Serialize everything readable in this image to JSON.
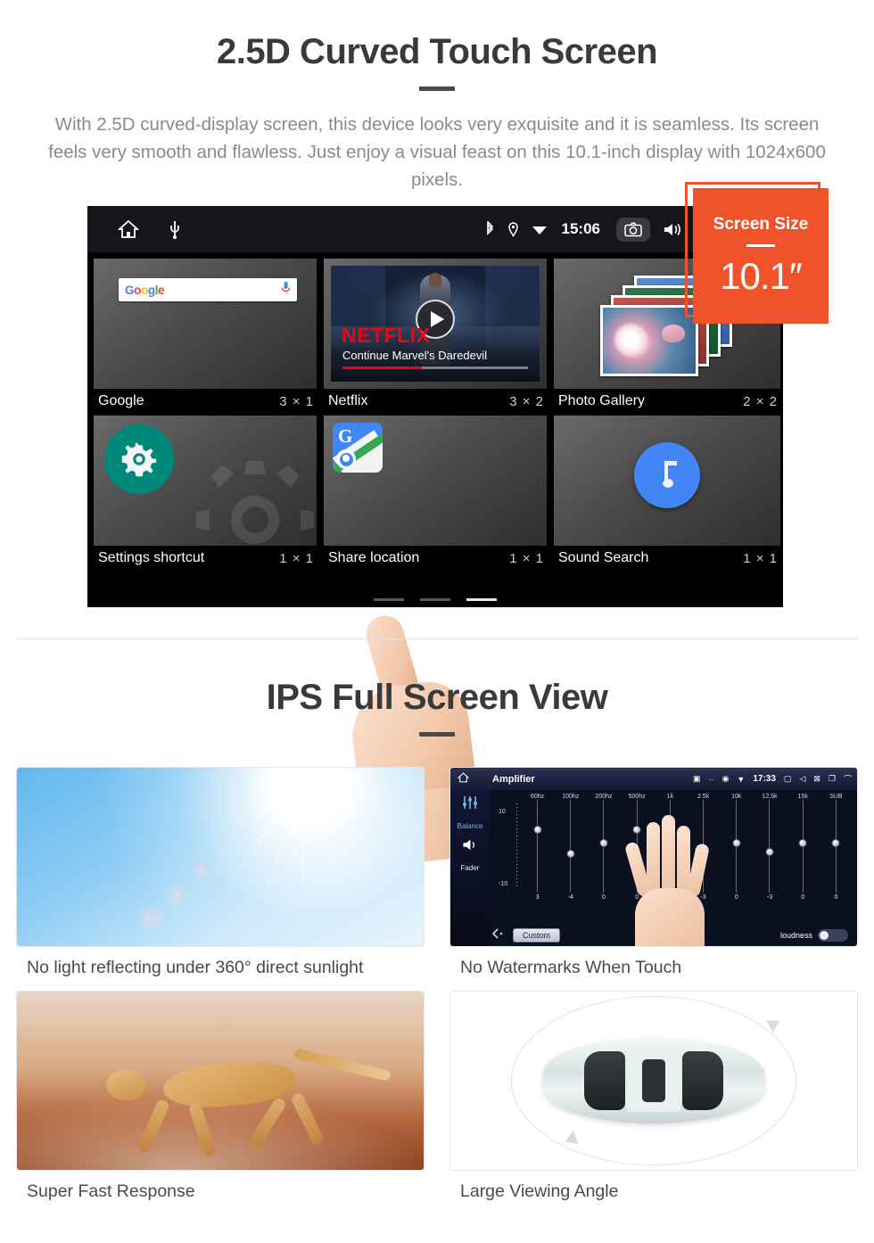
{
  "section1": {
    "title": "2.5D Curved Touch Screen",
    "description": "With 2.5D curved-display screen, this device looks very exquisite and it is seamless. Its screen feels very smooth and flawless. Just enjoy a visual feast on this 10.1-inch display with 1024x600 pixels."
  },
  "badge": {
    "title": "Screen Size",
    "value": "10.1″",
    "color": "#F0522A"
  },
  "device": {
    "statusbar": {
      "time": "15:06",
      "left_icons": [
        "home-icon",
        "usb-icon"
      ],
      "right_icons": [
        "bluetooth-icon",
        "location-icon",
        "wifi-icon",
        "camera-icon",
        "volume-icon",
        "close-icon",
        "recents-icon",
        "back-icon"
      ]
    },
    "widgets": [
      {
        "label": "Google",
        "size": "3 × 1",
        "icon": "google-search-widget"
      },
      {
        "label": "Netflix",
        "size": "3 × 2",
        "icon": "netflix-widget"
      },
      {
        "label": "Photo Gallery",
        "size": "2 × 2",
        "icon": "photo-gallery-widget"
      },
      {
        "label": "Settings shortcut",
        "size": "1 × 1",
        "icon": "settings-gear-icon"
      },
      {
        "label": "Share location",
        "size": "1 × 1",
        "icon": "google-maps-icon"
      },
      {
        "label": "Sound Search",
        "size": "1 × 1",
        "icon": "music-note-icon"
      }
    ],
    "google_widget": {
      "logo": "Google",
      "mic": "mic-icon"
    },
    "netflix_widget": {
      "brand": "NETFLIX",
      "subtitle": "Continue Marvel's Daredevil",
      "progress_percent": 43
    },
    "page_indicator": {
      "count": 3,
      "active": 3
    }
  },
  "section2": {
    "title": "IPS Full Screen View",
    "cards": [
      {
        "caption": "No light reflecting under 360° direct sunlight",
        "media": "sunlight-photo"
      },
      {
        "caption": "No Watermarks When Touch",
        "media": "amplifier-screenshot"
      },
      {
        "caption": "Super Fast Response",
        "media": "cheetah-photo"
      },
      {
        "caption": "Large Viewing Angle",
        "media": "car-top-view-diagram"
      }
    ]
  },
  "amplifier": {
    "title": "Amplifier",
    "time": "17:33",
    "side_labels": [
      "Balance",
      "Fader"
    ],
    "scale_top": "10",
    "scale_bottom": "-10",
    "bands": [
      "60hz",
      "100hz",
      "200hz",
      "500hz",
      "1k",
      "2.5k",
      "10k",
      "12.5k",
      "15k",
      "SUB"
    ],
    "values": [
      "3",
      "-4",
      "0",
      "0",
      "0",
      "-3",
      "0",
      "-3",
      "0",
      "0"
    ],
    "preset_button": "Custom",
    "loudness_label": "loudness",
    "loudness_on": true
  }
}
